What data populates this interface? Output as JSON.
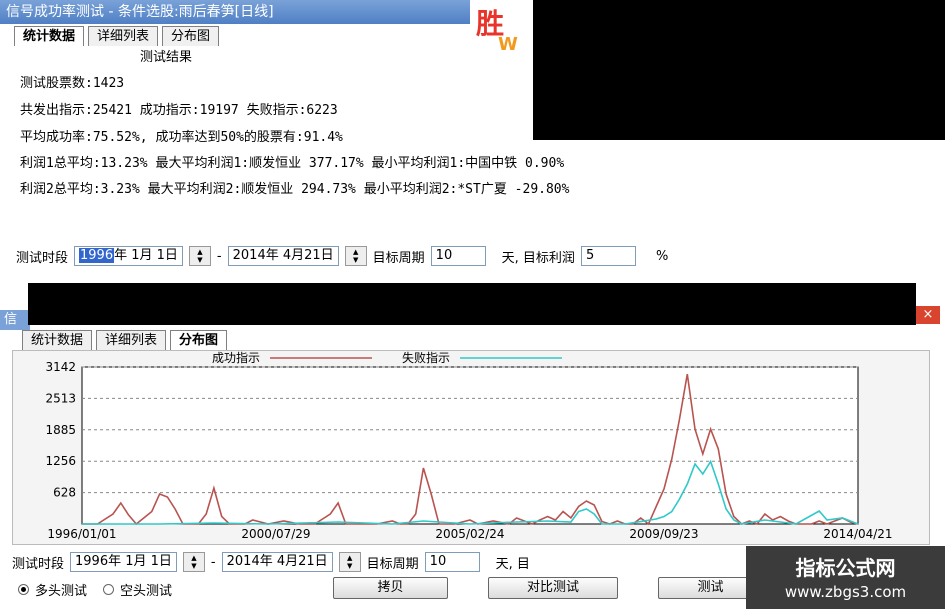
{
  "window1": {
    "title": "信号成功率测试 - 条件选股:雨后春笋[日线]",
    "tabs": [
      "统计数据",
      "详细列表",
      "分布图"
    ],
    "result_title": "测试结果",
    "stats": [
      "测试股票数:1423",
      "共发出指示:25421  成功指示:19197  失败指示:6223",
      "平均成功率:75.52%, 成功率达到50%的股票有:91.4%",
      "利润1总平均:13.23% 最大平均利润1:顺发恒业 377.17% 最小平均利润1:中国中铁  0.90%",
      "利润2总平均:3.23% 最大平均利润2:顺发恒业 294.73% 最小平均利润2:*ST广夏   -29.80%"
    ],
    "controls": {
      "period_label": "测试时段",
      "start_year": "1996",
      "start_rest": "年  1月  1日",
      "end_date": "2014年  4月21日",
      "target_period_label": "目标周期",
      "target_period_value": "10",
      "days_label": "天, 目标利润",
      "target_profit_value": "5",
      "percent": "%"
    },
    "logo_text": "胜",
    "logo_sub": "W"
  },
  "window2": {
    "title": "信",
    "close": "×",
    "tabs": [
      "统计数据",
      "详细列表",
      "分布图"
    ],
    "controls": {
      "period_label": "测试时段",
      "start_date": "1996年  1月  1日",
      "end_date": "2014年  4月21日",
      "target_period_label": "目标周期",
      "target_period_value": "10",
      "days_label": "天, 目"
    },
    "radio_long": "多头测试",
    "radio_short": "空头测试",
    "buttons": {
      "copy": "拷贝",
      "compare": "对比测试",
      "test": "测试"
    }
  },
  "watermark": {
    "line1": "指标公式网",
    "line2": "www.zbgs3.com"
  },
  "colors": {
    "success": "#b85450",
    "fail": "#30c8c8",
    "title_bar": "#5b87c8"
  },
  "chart_data": {
    "type": "line",
    "title": "",
    "xlabel": "",
    "ylabel": "",
    "x_tick_labels": [
      "1996/01/01",
      "2000/07/29",
      "2005/02/24",
      "2009/09/23",
      "2014/04/21"
    ],
    "y_tick_labels": [
      "3142",
      "2513",
      "1885",
      "1256",
      "628"
    ],
    "ylim": [
      0,
      3142
    ],
    "x_index_range": [
      0,
      100
    ],
    "legend_position": "top",
    "grid": true,
    "series": [
      {
        "name": "成功指示",
        "color": "#b85450",
        "points": [
          [
            0,
            0
          ],
          [
            2,
            0
          ],
          [
            4,
            200
          ],
          [
            5,
            420
          ],
          [
            6,
            180
          ],
          [
            7,
            0
          ],
          [
            9,
            250
          ],
          [
            10,
            600
          ],
          [
            11,
            540
          ],
          [
            12,
            300
          ],
          [
            13,
            0
          ],
          [
            14,
            0
          ],
          [
            15,
            0
          ],
          [
            16,
            200
          ],
          [
            17,
            720
          ],
          [
            18,
            150
          ],
          [
            19,
            0
          ],
          [
            21,
            0
          ],
          [
            22,
            80
          ],
          [
            24,
            0
          ],
          [
            26,
            60
          ],
          [
            28,
            0
          ],
          [
            30,
            0
          ],
          [
            32,
            200
          ],
          [
            33,
            420
          ],
          [
            34,
            0
          ],
          [
            36,
            0
          ],
          [
            38,
            0
          ],
          [
            40,
            60
          ],
          [
            41,
            0
          ],
          [
            42,
            0
          ],
          [
            43,
            200
          ],
          [
            44,
            1120
          ],
          [
            45,
            600
          ],
          [
            46,
            0
          ],
          [
            48,
            0
          ],
          [
            50,
            80
          ],
          [
            51,
            0
          ],
          [
            53,
            60
          ],
          [
            55,
            0
          ],
          [
            56,
            120
          ],
          [
            57,
            60
          ],
          [
            58,
            0
          ],
          [
            59,
            80
          ],
          [
            60,
            150
          ],
          [
            61,
            80
          ],
          [
            62,
            250
          ],
          [
            63,
            120
          ],
          [
            64,
            350
          ],
          [
            65,
            460
          ],
          [
            66,
            380
          ],
          [
            67,
            50
          ],
          [
            68,
            0
          ],
          [
            69,
            60
          ],
          [
            70,
            0
          ],
          [
            71,
            0
          ],
          [
            72,
            120
          ],
          [
            73,
            0
          ],
          [
            74,
            350
          ],
          [
            75,
            700
          ],
          [
            76,
            1300
          ],
          [
            77,
            2100
          ],
          [
            78,
            3000
          ],
          [
            79,
            1900
          ],
          [
            80,
            1400
          ],
          [
            81,
            1900
          ],
          [
            82,
            1500
          ],
          [
            83,
            600
          ],
          [
            84,
            150
          ],
          [
            85,
            0
          ],
          [
            86,
            60
          ],
          [
            87,
            0
          ],
          [
            88,
            200
          ],
          [
            89,
            80
          ],
          [
            90,
            150
          ],
          [
            91,
            60
          ],
          [
            92,
            0
          ],
          [
            94,
            0
          ],
          [
            95,
            60
          ],
          [
            96,
            0
          ],
          [
            98,
            120
          ],
          [
            99,
            40
          ],
          [
            100,
            0
          ]
        ]
      },
      {
        "name": "失败指示",
        "color": "#30c8c8",
        "points": [
          [
            0,
            0
          ],
          [
            10,
            0
          ],
          [
            17,
            20
          ],
          [
            24,
            0
          ],
          [
            33,
            40
          ],
          [
            40,
            0
          ],
          [
            44,
            60
          ],
          [
            50,
            0
          ],
          [
            56,
            40
          ],
          [
            60,
            60
          ],
          [
            63,
            40
          ],
          [
            64,
            250
          ],
          [
            65,
            300
          ],
          [
            66,
            200
          ],
          [
            67,
            0
          ],
          [
            70,
            0
          ],
          [
            74,
            100
          ],
          [
            75,
            150
          ],
          [
            76,
            250
          ],
          [
            77,
            500
          ],
          [
            78,
            800
          ],
          [
            79,
            1200
          ],
          [
            80,
            1000
          ],
          [
            81,
            1250
          ],
          [
            82,
            800
          ],
          [
            83,
            300
          ],
          [
            84,
            80
          ],
          [
            85,
            0
          ],
          [
            88,
            80
          ],
          [
            90,
            40
          ],
          [
            92,
            0
          ],
          [
            95,
            260
          ],
          [
            96,
            80
          ],
          [
            98,
            120
          ],
          [
            100,
            0
          ]
        ]
      }
    ]
  }
}
